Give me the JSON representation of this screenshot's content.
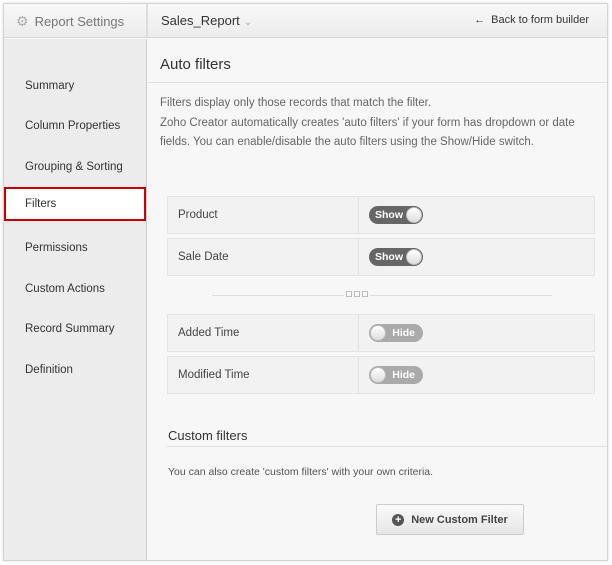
{
  "header": {
    "settings_label": "Report Settings",
    "report_name": "Sales_Report",
    "back_label": "Back to form builder"
  },
  "sidebar": {
    "items": [
      {
        "label": "Summary"
      },
      {
        "label": "Column Properties"
      },
      {
        "label": "Grouping & Sorting"
      },
      {
        "label": "Filters"
      },
      {
        "label": "Permissions"
      },
      {
        "label": "Custom Actions"
      },
      {
        "label": "Record Summary"
      },
      {
        "label": "Definition"
      }
    ],
    "active": "Filters"
  },
  "auto": {
    "title": "Auto filters",
    "desc1": "Filters display only those records that match the filter.",
    "desc2": "Zoho Creator automatically creates 'auto filters' if your form has dropdown or date fields. You can enable/disable the auto filters using the Show/Hide switch.",
    "rows": [
      {
        "label": "Product",
        "state": "Show"
      },
      {
        "label": "Sale Date",
        "state": "Show"
      },
      {
        "label": "Added Time",
        "state": "Hide"
      },
      {
        "label": "Modified Time",
        "state": "Hide"
      }
    ]
  },
  "custom": {
    "title": "Custom filters",
    "desc": "You can also create 'custom filters' with your own criteria.",
    "button": "New Custom Filter"
  }
}
